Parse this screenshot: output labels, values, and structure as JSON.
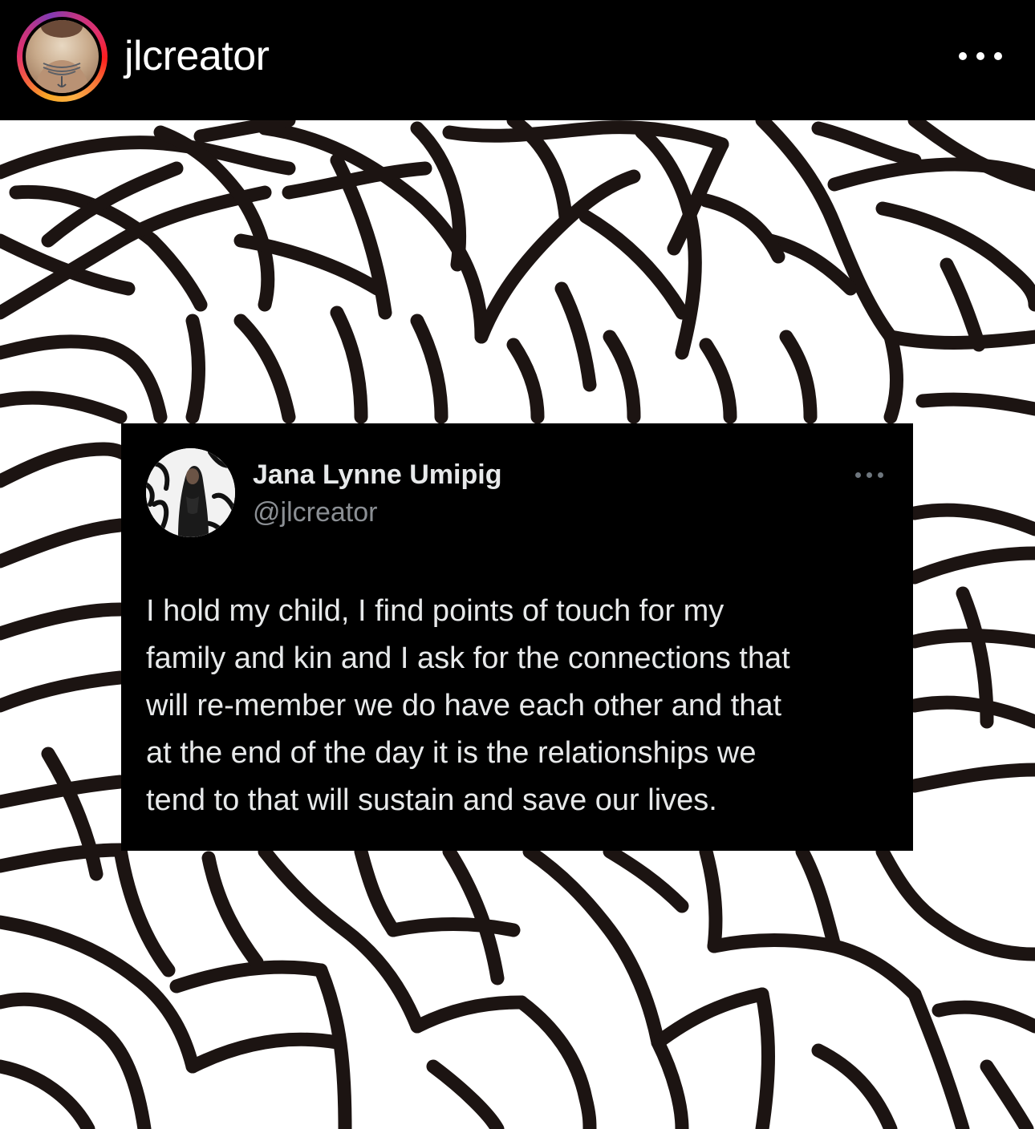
{
  "post": {
    "username": "jlcreator",
    "more_icon": "ellipsis-horizontal-icon",
    "ring_colors": [
      "#f9a825",
      "#f56040",
      "#e1306c",
      "#c13584",
      "#833ab4"
    ]
  },
  "tweet": {
    "display_name": "Jana Lynne Umipig",
    "handle": "@jlcreator",
    "more_icon": "ellipsis-horizontal-icon",
    "text_lines": [
      "I hold my child, I find points of touch for my",
      "family and kin and I ask for the connections that",
      "will re-member we do have each other and that",
      "at the end of the day it is the relationships we",
      "tend to that will sustain and save our lives."
    ]
  },
  "colors": {
    "header_bg": "#000000",
    "pattern_line": "#1c1412",
    "pattern_bg": "#ffffff",
    "tweet_bg": "#000000",
    "tweet_text": "#e7e9ea",
    "tweet_handle": "#8b8f94"
  }
}
